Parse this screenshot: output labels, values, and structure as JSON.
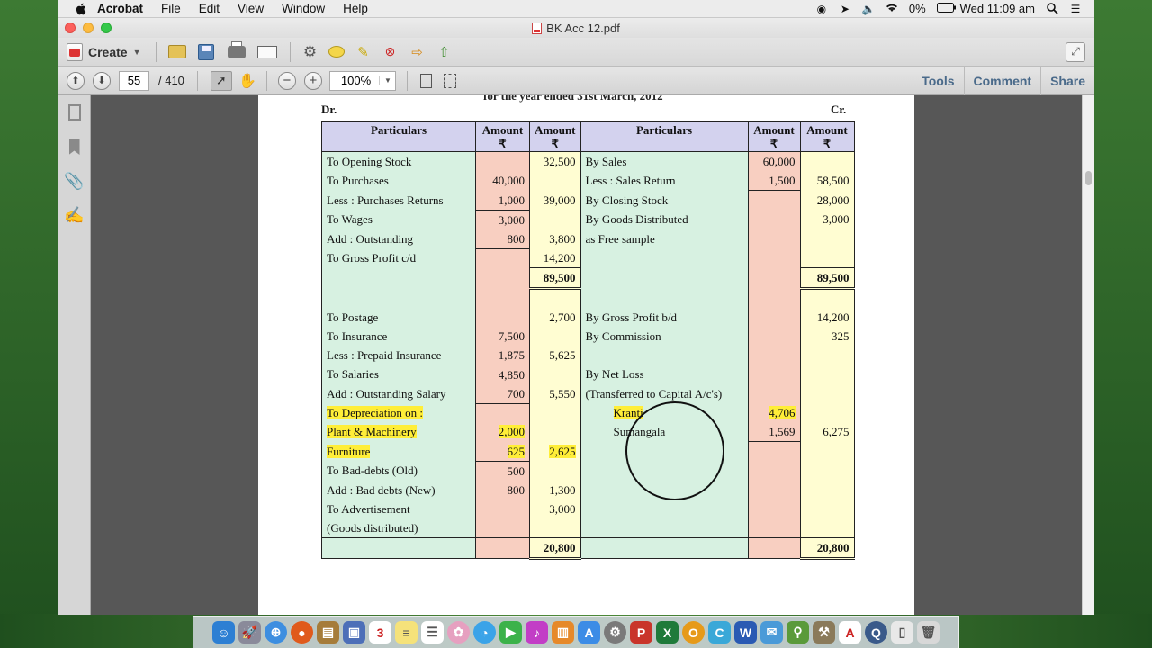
{
  "menubar": {
    "apple": "",
    "items": [
      "Acrobat",
      "File",
      "Edit",
      "View",
      "Window",
      "Help"
    ],
    "battery": "0%",
    "clock": "Wed 11:09 am"
  },
  "window": {
    "title": "BK Acc 12.pdf"
  },
  "toolbar": {
    "create_label": "Create",
    "page_current": "55",
    "page_total": "/ 410",
    "zoom": "100%",
    "tools_label": "Tools",
    "comment_label": "Comment",
    "share_label": "Share"
  },
  "document": {
    "cut_heading": "for the year ended 31st March, 2012",
    "dr": "Dr.",
    "cr": "Cr.",
    "headers": {
      "particulars": "Particulars",
      "amount": "Amount",
      "rupee": "₹"
    },
    "trading_rows": [
      {
        "p": "To Opening Stock",
        "a": "",
        "b": "32,500",
        "q": "By Sales",
        "c": "60,000",
        "d": ""
      },
      {
        "p": "To Purchases",
        "a": "40,000",
        "b": "",
        "q": "Less : Sales Return",
        "c": "1,500",
        "d": "58,500"
      },
      {
        "p": "Less : Purchases Returns",
        "a": "1,000",
        "b": "39,000",
        "q": "By Closing Stock",
        "c": "",
        "d": "28,000"
      },
      {
        "p": "To Wages",
        "a": "3,000",
        "b": "",
        "q": "By Goods Distributed",
        "c": "",
        "d": "3,000"
      },
      {
        "p": "Add : Outstanding",
        "a": "800",
        "b": "3,800",
        "q": "as Free sample",
        "c": "",
        "d": ""
      },
      {
        "p": "To Gross Profit c/d",
        "a": "",
        "b": "14,200",
        "q": "",
        "c": "",
        "d": ""
      }
    ],
    "trading_total_left": "89,500",
    "trading_total_right": "89,500",
    "pl_rows": [
      {
        "p": "To Postage",
        "a": "",
        "b": "2,700",
        "q": "By Gross Profit b/d",
        "c": "",
        "d": "14,200"
      },
      {
        "p": "To Insurance",
        "a": "7,500",
        "b": "",
        "q": "By Commission",
        "c": "",
        "d": "325"
      },
      {
        "p": "Less : Prepaid Insurance",
        "a": "1,875",
        "b": "5,625",
        "q": "",
        "c": "",
        "d": ""
      },
      {
        "p": "To Salaries",
        "a": "4,850",
        "b": "",
        "q": "By Net Loss",
        "c": "",
        "d": ""
      },
      {
        "p": "Add : Outstanding Salary",
        "a": "700",
        "b": "5,550",
        "q": "(Transferred to Capital A/c's)",
        "c": "",
        "d": ""
      },
      {
        "p": "To Depreciation on :",
        "a": "",
        "b": "",
        "q": "Kranti",
        "c": "4,706",
        "d": ""
      },
      {
        "p": "Plant & Machinery",
        "a": "2,000",
        "b": "",
        "q": "Sumangala",
        "c": "1,569",
        "d": "6,275"
      },
      {
        "p": "Furniture",
        "a": "625",
        "b": "2,625",
        "q": "",
        "c": "",
        "d": ""
      },
      {
        "p": "To Bad-debts (Old)",
        "a": "500",
        "b": "",
        "q": "",
        "c": "",
        "d": ""
      },
      {
        "p": "Add : Bad debts (New)",
        "a": "800",
        "b": "1,300",
        "q": "",
        "c": "",
        "d": ""
      },
      {
        "p": "To Advertisement",
        "a": "",
        "b": "3,000",
        "q": "",
        "c": "",
        "d": ""
      },
      {
        "p": "(Goods distributed)",
        "a": "",
        "b": "",
        "q": "",
        "c": "",
        "d": ""
      }
    ],
    "pl_total_left": "20,800",
    "pl_total_right": "20,800"
  },
  "colors": {
    "particulars_bg": "#d7f1e1",
    "amount_bg": "#f8cfc1",
    "total_bg": "#fffdd2",
    "header_bg": "#d3d2ee",
    "highlight": "#ffee38"
  }
}
